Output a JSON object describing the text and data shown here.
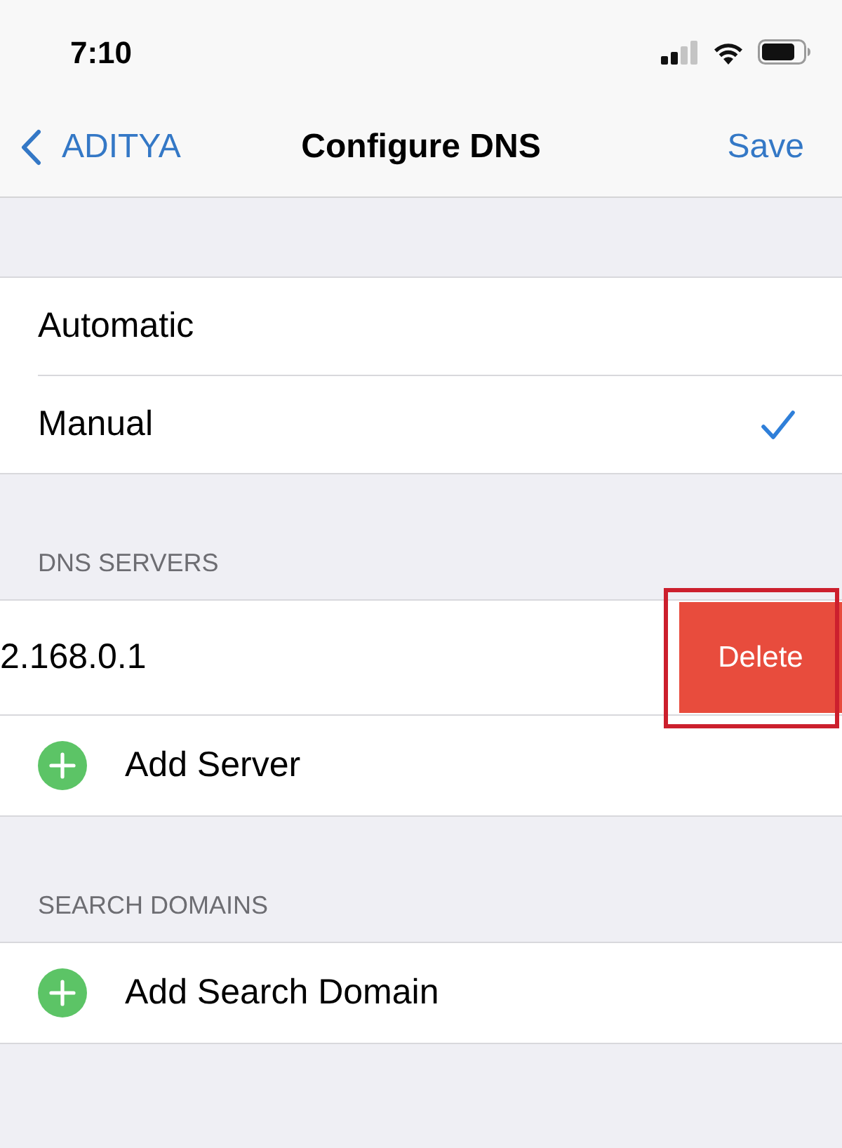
{
  "status_bar": {
    "time": "7:10"
  },
  "nav": {
    "back": "ADITYA",
    "title": "Configure DNS",
    "action": "Save"
  },
  "mode_options": [
    {
      "label": "Automatic",
      "selected": false
    },
    {
      "label": "Manual",
      "selected": true
    }
  ],
  "sections": [
    {
      "header": "DNS SERVERS",
      "entries": [
        {
          "value": "2.168.0.1",
          "swipe_action": "Delete",
          "highlighted": true
        }
      ],
      "add_label": "Add Server"
    },
    {
      "header": "SEARCH DOMAINS",
      "add_label": "Add Search Domain"
    }
  ]
}
